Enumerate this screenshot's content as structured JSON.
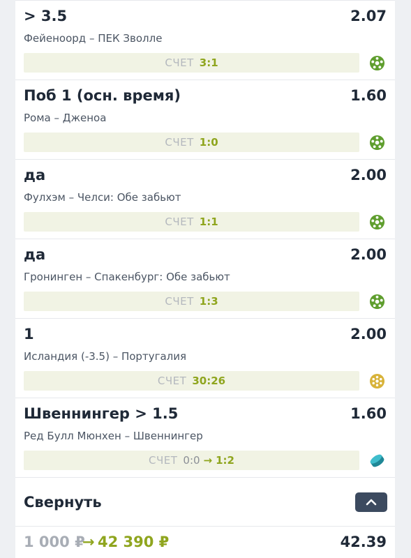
{
  "bets": [
    {
      "selection": "> 3.5",
      "odds": "2.07",
      "match": "Фейеноорд – ПЕК Зволле",
      "score_label": "СЧЕТ",
      "score": "3:1",
      "sport_icon": "football-icon"
    },
    {
      "selection": "Поб 1 (осн. время)",
      "odds": "1.60",
      "match": "Рома – Дженоа",
      "score_label": "СЧЕТ",
      "score": "1:0",
      "sport_icon": "football-icon"
    },
    {
      "selection": "да",
      "odds": "2.00",
      "match": "Фулхэм – Челси: Обе забьют",
      "score_label": "СЧЕТ",
      "score": "1:1",
      "sport_icon": "football-icon"
    },
    {
      "selection": "да",
      "odds": "2.00",
      "match": "Гронинген – Спакенбург: Обе забьют",
      "score_label": "СЧЕТ",
      "score": "1:3",
      "sport_icon": "football-icon"
    },
    {
      "selection": "1",
      "odds": "2.00",
      "match": "Исландия (-3.5) – Португалия",
      "score_label": "СЧЕТ",
      "score": "30:26",
      "sport_icon": "handball-icon"
    },
    {
      "selection": "Швеннингер > 1.5",
      "odds": "1.60",
      "match": "Ред Булл Мюнхен – Швеннингер",
      "score_label": "СЧЕТ",
      "score_from": "0:0",
      "score": "1:2",
      "sport_icon": "hockey-puck-icon"
    }
  ],
  "collapse": {
    "label": "Свернуть",
    "icon": "chevron-up-icon"
  },
  "summary": {
    "stake": "1 000 ₽",
    "arrow": "→",
    "payout": "42 390 ₽",
    "total_odds": "42.39"
  },
  "colors": {
    "accent": "#8fa51e",
    "football": "#5f9e2e",
    "handball": "#d8b33a",
    "hockey": "#2fa8b8",
    "button": "#3c4a5f"
  }
}
